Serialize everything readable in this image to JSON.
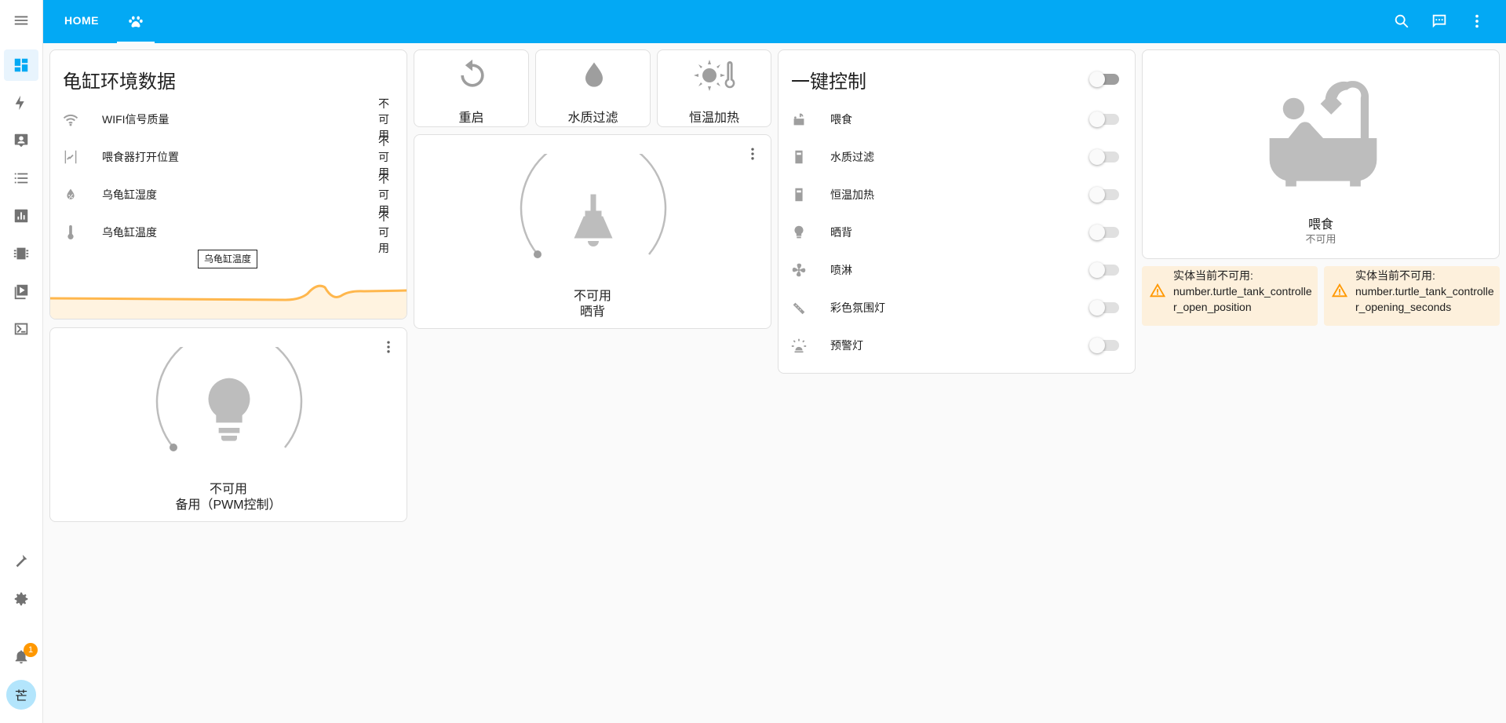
{
  "header": {
    "tab_home": "HOME"
  },
  "sidebar": {
    "notification_count": "1",
    "user_initial": "芒"
  },
  "env_card": {
    "title": "龟缸环境数据",
    "rows": [
      {
        "name": "WIFI信号质量",
        "value": "不可用",
        "icon": "wifi-icon"
      },
      {
        "name": "喂食器打开位置",
        "value": "不可用",
        "icon": "position-icon"
      },
      {
        "name": "乌龟缸湿度",
        "value": "不可用",
        "icon": "humidity-icon"
      },
      {
        "name": "乌龟缸温度",
        "value": "不可用",
        "icon": "thermometer-icon"
      }
    ],
    "graph_tooltip": "乌龟缸温度",
    "graph_color": "#ffb74d"
  },
  "buttons": [
    {
      "label": "重启",
      "icon": "restart-icon"
    },
    {
      "label": "水质过滤",
      "icon": "water-drop-icon"
    },
    {
      "label": "恒温加热",
      "icon": "sun-thermometer-icon"
    }
  ],
  "lamp_card": {
    "state": "不可用",
    "name": "晒背",
    "icon": "ceiling-lamp-icon"
  },
  "bulb_card": {
    "state": "不可用",
    "name": "备用（PWM控制）",
    "icon": "lightbulb-icon"
  },
  "control_card": {
    "title": "一键控制",
    "rows": [
      {
        "name": "喂食",
        "icon": "feeder-icon"
      },
      {
        "name": "水质过滤",
        "icon": "filter-icon"
      },
      {
        "name": "恒温加热",
        "icon": "heater-icon"
      },
      {
        "name": "晒背",
        "icon": "bulb-small-icon"
      },
      {
        "name": "喷淋",
        "icon": "fan-icon"
      },
      {
        "name": "彩色氛围灯",
        "icon": "led-strip-icon"
      },
      {
        "name": "预警灯",
        "icon": "alarm-light-icon"
      }
    ]
  },
  "feed_card": {
    "name": "喂食",
    "state": "不可用",
    "icon": "bathtub-icon"
  },
  "warnings": [
    {
      "prefix": "实体当前不可用:",
      "entity": "number.turtle_tank_controller_open_position"
    },
    {
      "prefix": "实体当前不可用:",
      "entity": "number.turtle_tank_controller_opening_seconds"
    }
  ],
  "colors": {
    "primary": "#03a9f4",
    "icon_grey": "#9e9e9e",
    "warning": "#ff9800",
    "warning_bg": "#fdf0dc"
  }
}
